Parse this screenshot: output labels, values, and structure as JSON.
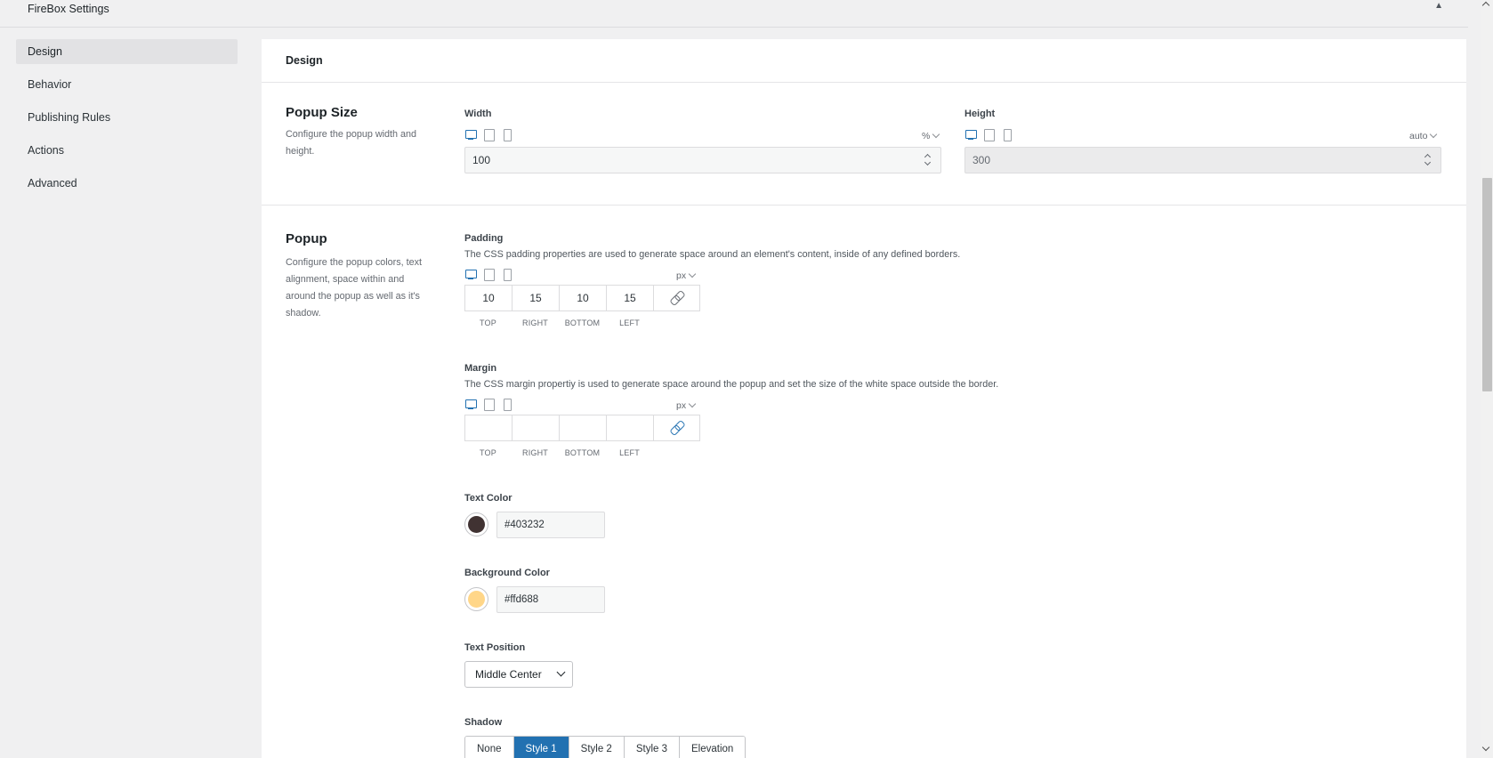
{
  "topbar": {
    "title": "FireBox Settings",
    "collapse_icon": "triangle-up-icon"
  },
  "sidebar": {
    "items": [
      {
        "label": "Design",
        "active": true
      },
      {
        "label": "Behavior"
      },
      {
        "label": "Publishing Rules"
      },
      {
        "label": "Actions"
      },
      {
        "label": "Advanced"
      }
    ]
  },
  "panel": {
    "header": "Design"
  },
  "popup_size": {
    "title": "Popup Size",
    "description": "Configure the popup width and height.",
    "width": {
      "label": "Width",
      "unit": "%",
      "value": "100"
    },
    "height": {
      "label": "Height",
      "unit": "auto",
      "value": "300"
    }
  },
  "popup": {
    "title": "Popup",
    "description": "Configure the popup colors, text alignment, space within and around the popup as well as it's shadow.",
    "padding": {
      "label": "Padding",
      "description": "The CSS padding properties are used to generate space around an element's content, inside of any defined borders.",
      "unit": "px",
      "top": "10",
      "right": "15",
      "bottom": "10",
      "left": "15"
    },
    "margin": {
      "label": "Margin",
      "description": "The CSS margin propertiy is used to generate space around the popup and set the size of the white space outside the border.",
      "unit": "px",
      "top": "",
      "right": "",
      "bottom": "",
      "left": ""
    },
    "dim_labels": {
      "top": "TOP",
      "right": "RIGHT",
      "bottom": "BOTTOM",
      "left": "LEFT"
    },
    "text_color": {
      "label": "Text Color",
      "value": "#403232",
      "swatch": "#403232"
    },
    "background_color": {
      "label": "Background Color",
      "value": "#ffd688",
      "swatch": "#ffd688"
    },
    "text_position": {
      "label": "Text Position",
      "value": "Middle Center"
    },
    "shadow": {
      "label": "Shadow",
      "options": [
        "None",
        "Style 1",
        "Style 2",
        "Style 3",
        "Elevation"
      ],
      "selected": "Style 1"
    }
  },
  "colors": {
    "accent": "#2271b1"
  }
}
